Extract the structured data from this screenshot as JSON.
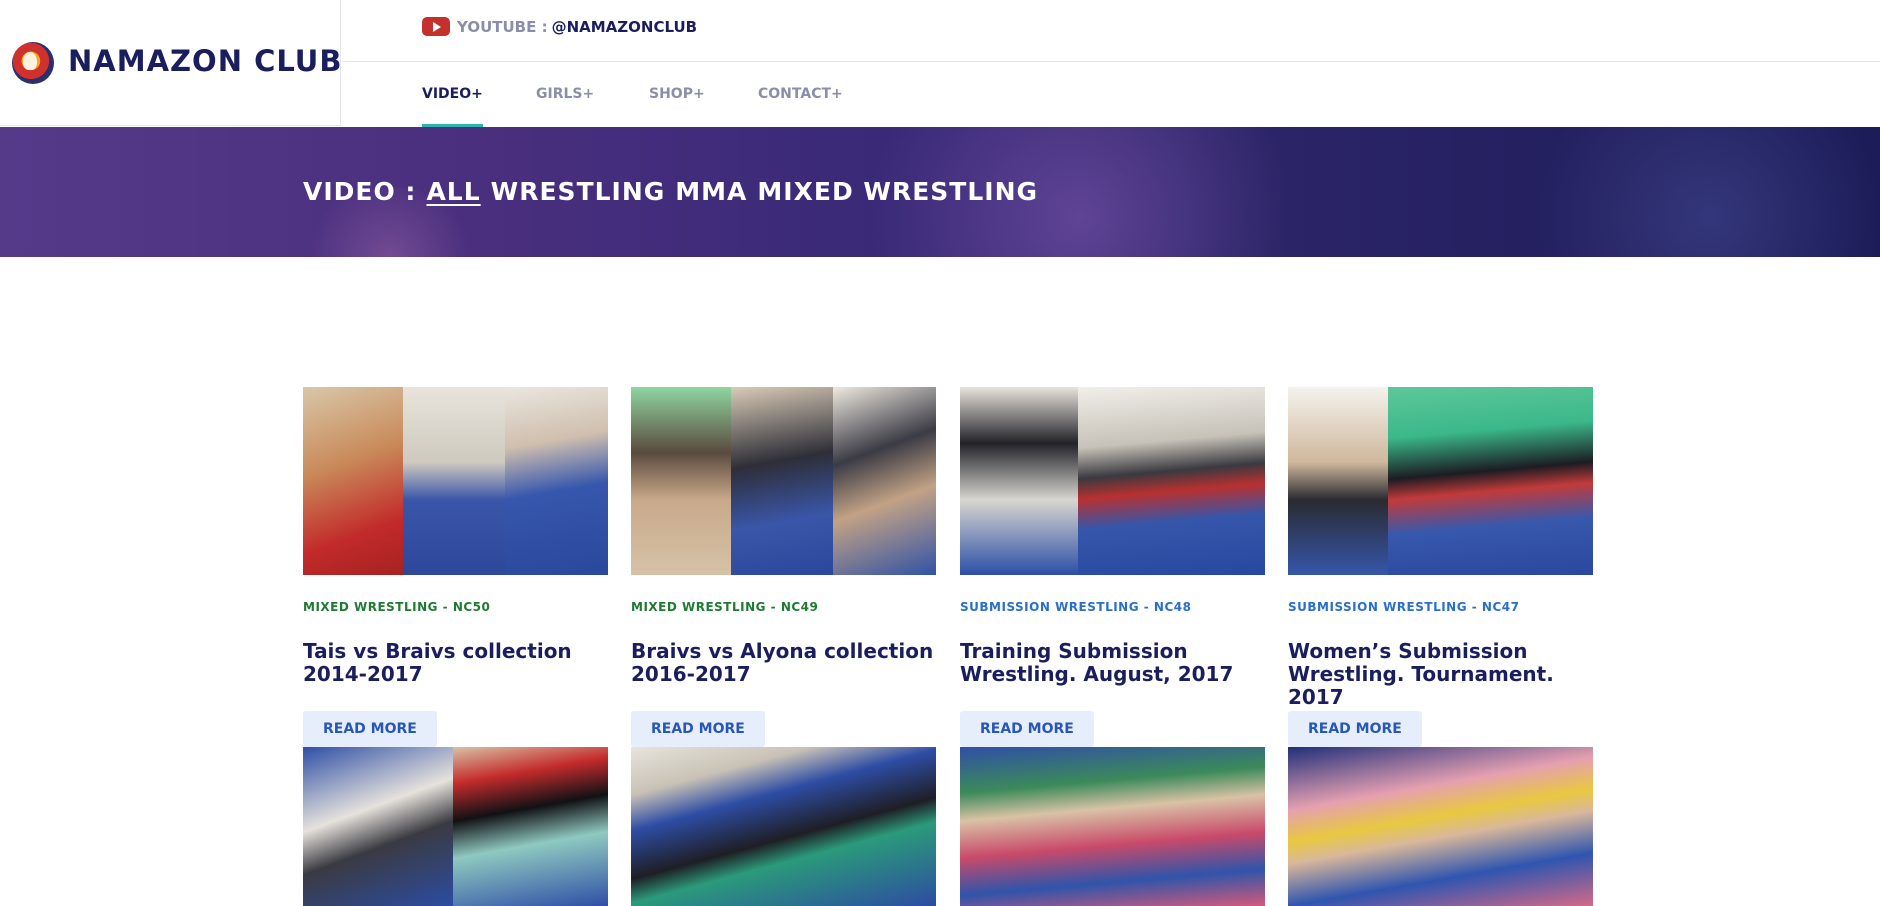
{
  "brand": {
    "name": "NAMAZON CLUB"
  },
  "youtube": {
    "label": "YOUTUBE :",
    "handle": "@NAMAZONCLUB"
  },
  "nav": [
    "VIDEO+",
    "GIRLS+",
    "SHOP+",
    "CONTACT+"
  ],
  "banner": {
    "prefix": "VIDEO :",
    "filters": [
      "ALL",
      "WRESTLING",
      "MMA",
      "MIXED WRESTLING"
    ]
  },
  "colors": {
    "mixed": "#1f7a32",
    "submission": "#2a6fc9",
    "accent": "#2bb5b0"
  },
  "cards": [
    {
      "category": "MIXED WRESTLING - NC50",
      "title": "Tais vs Braivs collection 2014-2017",
      "button": "READ MORE"
    },
    {
      "category": "MIXED WRESTLING - NC49",
      "title": "Braivs vs Alyona collection 2016-2017",
      "button": "READ MORE"
    },
    {
      "category": "SUBMISSION WRESTLING - NC48",
      "title": "Training Submission Wrestling. August, 2017",
      "button": "READ MORE"
    },
    {
      "category": "SUBMISSION WRESTLING - NC47",
      "title": "Women’s Submission Wrestling. Tournament. 2017",
      "button": "READ MORE"
    }
  ]
}
